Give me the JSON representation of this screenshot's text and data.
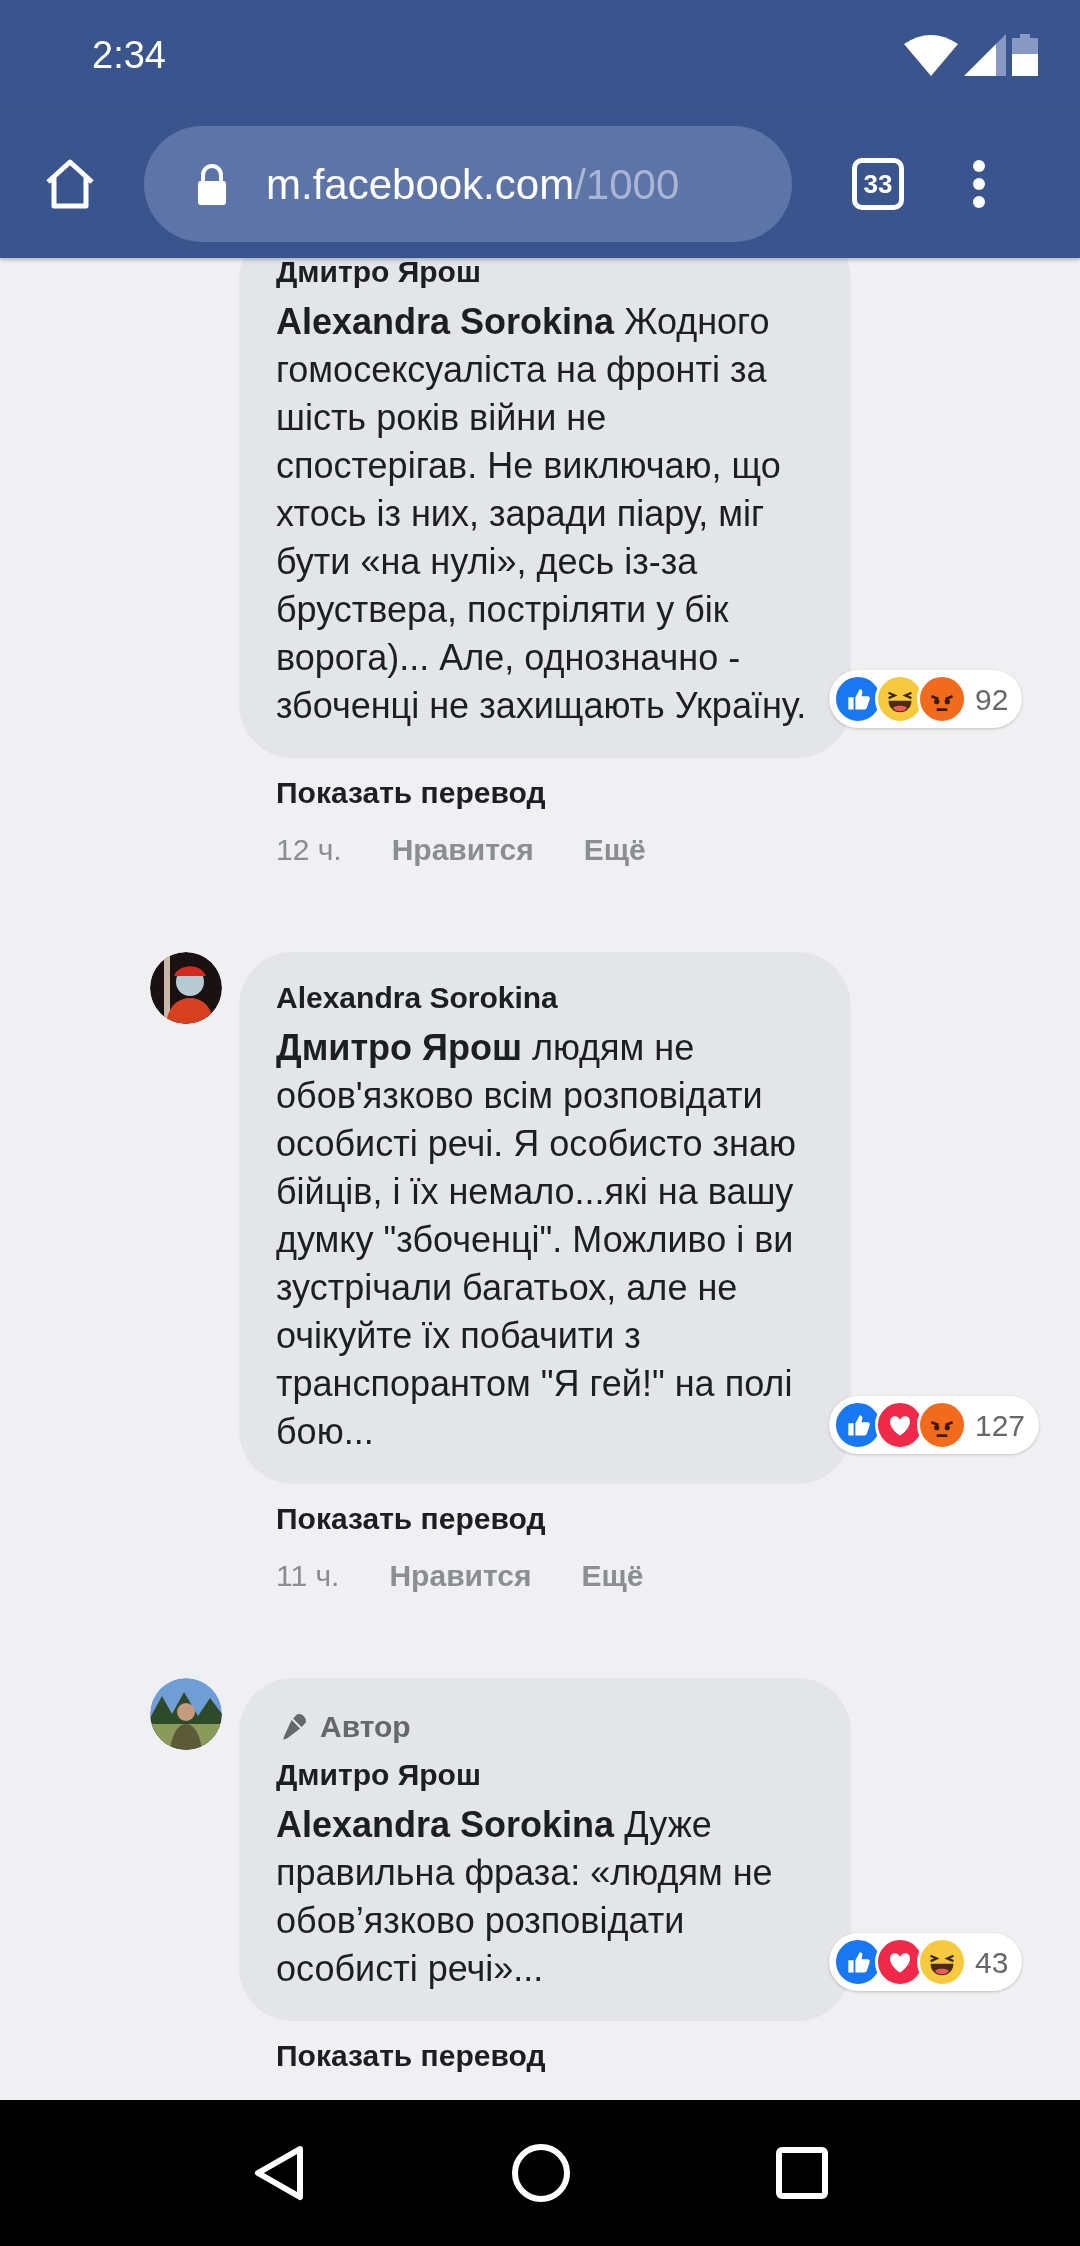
{
  "status_bar": {
    "time": "2:34"
  },
  "browser": {
    "url_host": "m.facebook.com",
    "url_path": "/1000",
    "tab_count": "33"
  },
  "comments": [
    {
      "avatar": false,
      "author": "Дмитро Ярош",
      "text": "**Alexandra Sorokina** Жодного гомосексуаліста на фронті за шість років війни не спостерігав. Не виключаю, що хтось із них, заради піару, міг бути «на нулі», десь із-за бруствера, постріляти у бік ворога)... Але, однозначно - збоченці не захищають Україну.",
      "reactions": [
        {
          "kind": "like"
        },
        {
          "kind": "haha"
        },
        {
          "kind": "angry"
        }
      ],
      "reaction_count": "92",
      "translate": "Показать перевод",
      "time": "12 ч.",
      "like": "Нравится",
      "more": "Ещё"
    },
    {
      "avatar": true,
      "author": "Alexandra Sorokina",
      "text": "**Дмитро Ярош** людям не обов'язково всім розповідати особисті речі. Я особисто знаю бійців, і їх немало...які на вашу думку \"збоченці\". Можливо і ви зустрічали багатьох, але не очікуйте їх побачити з транспорантом \"Я гей!\" на полі бою...",
      "reactions": [
        {
          "kind": "like"
        },
        {
          "kind": "love"
        },
        {
          "kind": "angry"
        }
      ],
      "reaction_count": "127",
      "translate": "Показать перевод",
      "time": "11 ч.",
      "like": "Нравится",
      "more": "Ещё"
    },
    {
      "avatar": true,
      "author_badge": "Автор",
      "author": "Дмитро Ярош",
      "text": "**Alexandra Sorokina** Дуже правильна фраза: «людям не обов’язково розповідати особисті речі»...",
      "reactions": [
        {
          "kind": "like"
        },
        {
          "kind": "love"
        },
        {
          "kind": "haha"
        }
      ],
      "reaction_count": "43",
      "translate": "Показать перевод"
    }
  ]
}
